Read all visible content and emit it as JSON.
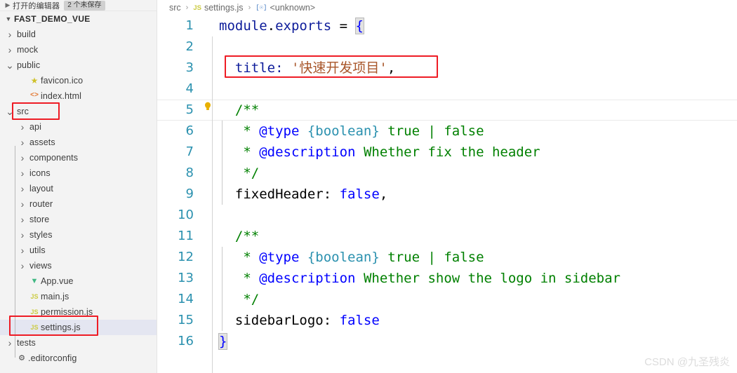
{
  "sidebar": {
    "open_editors": {
      "chevron": "chevron-right",
      "label": "打开的编辑器",
      "badge": "2 个未保存"
    },
    "root": {
      "chevron": "chevron-down",
      "label": "FAST_DEMO_VUE"
    },
    "items": [
      {
        "label": "build",
        "kind": "folder",
        "state": "collapsed",
        "depth": 1,
        "icon": "chevron-right-icon"
      },
      {
        "label": "mock",
        "kind": "folder",
        "state": "collapsed",
        "depth": 1,
        "icon": "chevron-right-icon"
      },
      {
        "label": "public",
        "kind": "folder",
        "state": "expanded",
        "depth": 1,
        "icon": "chevron-down-icon"
      },
      {
        "label": "favicon.ico",
        "kind": "file",
        "state": "none",
        "depth": 2,
        "icon": "star-icon"
      },
      {
        "label": "index.html",
        "kind": "file",
        "state": "none",
        "depth": 2,
        "icon": "html-icon"
      },
      {
        "label": "src",
        "kind": "folder",
        "state": "expanded",
        "depth": 1,
        "icon": "chevron-down-icon",
        "highlighted": true
      },
      {
        "label": "api",
        "kind": "folder",
        "state": "collapsed",
        "depth": 2,
        "icon": "chevron-right-icon"
      },
      {
        "label": "assets",
        "kind": "folder",
        "state": "collapsed",
        "depth": 2,
        "icon": "chevron-right-icon"
      },
      {
        "label": "components",
        "kind": "folder",
        "state": "collapsed",
        "depth": 2,
        "icon": "chevron-right-icon"
      },
      {
        "label": "icons",
        "kind": "folder",
        "state": "collapsed",
        "depth": 2,
        "icon": "chevron-right-icon"
      },
      {
        "label": "layout",
        "kind": "folder",
        "state": "collapsed",
        "depth": 2,
        "icon": "chevron-right-icon"
      },
      {
        "label": "router",
        "kind": "folder",
        "state": "collapsed",
        "depth": 2,
        "icon": "chevron-right-icon"
      },
      {
        "label": "store",
        "kind": "folder",
        "state": "collapsed",
        "depth": 2,
        "icon": "chevron-right-icon"
      },
      {
        "label": "styles",
        "kind": "folder",
        "state": "collapsed",
        "depth": 2,
        "icon": "chevron-right-icon"
      },
      {
        "label": "utils",
        "kind": "folder",
        "state": "collapsed",
        "depth": 2,
        "icon": "chevron-right-icon"
      },
      {
        "label": "views",
        "kind": "folder",
        "state": "collapsed",
        "depth": 2,
        "icon": "chevron-right-icon"
      },
      {
        "label": "App.vue",
        "kind": "file",
        "state": "none",
        "depth": 2,
        "icon": "vue-icon"
      },
      {
        "label": "main.js",
        "kind": "file",
        "state": "none",
        "depth": 2,
        "icon": "js-icon"
      },
      {
        "label": "permission.js",
        "kind": "file",
        "state": "none",
        "depth": 2,
        "icon": "js-icon"
      },
      {
        "label": "settings.js",
        "kind": "file",
        "state": "none",
        "depth": 2,
        "icon": "js-icon",
        "selected": true,
        "highlighted": true
      },
      {
        "label": "tests",
        "kind": "folder",
        "state": "collapsed",
        "depth": 1,
        "icon": "chevron-right-icon"
      },
      {
        "label": ".editorconfig",
        "kind": "file",
        "state": "none",
        "depth": 1,
        "icon": "gear-icon"
      }
    ]
  },
  "breadcrumb": {
    "folder": "src",
    "file": "settings.js",
    "symbol": "<unknown>",
    "separator": "›",
    "js_icon": "JS",
    "symbol_icon": "[☉]"
  },
  "editor": {
    "lines": [
      {
        "n": "1"
      },
      {
        "n": "2"
      },
      {
        "n": "3"
      },
      {
        "n": "4"
      },
      {
        "n": "5",
        "current": true,
        "bulb": true
      },
      {
        "n": "6"
      },
      {
        "n": "7"
      },
      {
        "n": "8"
      },
      {
        "n": "9"
      },
      {
        "n": "10"
      },
      {
        "n": "11"
      },
      {
        "n": "12"
      },
      {
        "n": "13"
      },
      {
        "n": "14"
      },
      {
        "n": "15"
      },
      {
        "n": "16"
      }
    ],
    "code": {
      "l1_module": "module",
      "l1_dot": ".",
      "l1_exports": "exports",
      "l1_eq": " = ",
      "l1_brace": "{",
      "l3_key": "title: ",
      "l3_value": "'快速开发项目'",
      "l3_comma": ",",
      "l5_open": "/**",
      "l6_star": " * ",
      "l6_tag": "@type",
      "l6_rest": " {boolean}",
      "l6_typename": " true | false",
      "l7_star": " * ",
      "l7_tag": "@description",
      "l7_rest": " Whether fix the header",
      "l8_close": " */",
      "l9_key": "fixedHeader: ",
      "l9_value": "false",
      "l9_comma": ",",
      "l11_open": "/**",
      "l12_star": " * ",
      "l12_tag": "@type",
      "l12_rest": " {boolean}",
      "l12_typename": " true | false",
      "l13_star": " * ",
      "l13_tag": "@description",
      "l13_rest": " Whether show the logo in sidebar",
      "l14_close": " */",
      "l15_key": "sidebarLogo: ",
      "l15_value": "false",
      "l16_brace": "}"
    }
  },
  "annotations": {
    "box_src": "red-highlight-src-folder",
    "box_settings": "red-highlight-settings-js",
    "box_title_line": "red-highlight-title-line"
  },
  "watermark": "CSDN @九圣残炎",
  "colors": {
    "annotation_red": "#ee1c25",
    "selection": "#e4e6f1",
    "sidebar_bg": "#f3f3f3",
    "line_number": "#2b91af",
    "comment_green": "#008000",
    "jsdoc_blue": "#0000ff",
    "type_cyan": "#2b91af",
    "string_orange": "#a8562a",
    "property_navy": "#0d1c9a"
  }
}
